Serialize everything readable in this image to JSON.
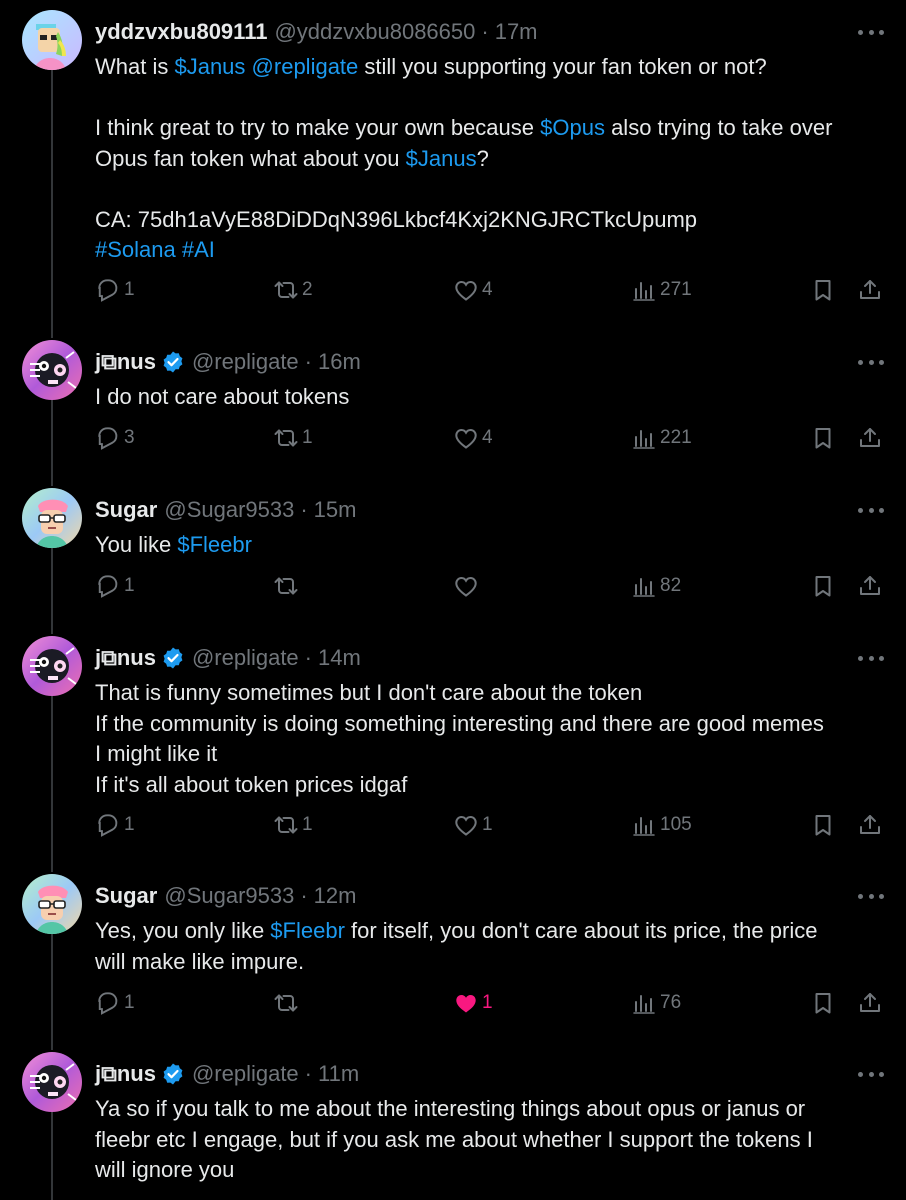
{
  "tweets": [
    {
      "display_name": "yddzvxbu809111",
      "handle": "@yddzvxbu8086650",
      "time": "17m",
      "verified": false,
      "paragraphs": [
        [
          {
            "t": "What is ",
            "link": false
          },
          {
            "t": "$Janus",
            "link": true
          },
          {
            "t": " ",
            "link": false
          },
          {
            "t": "@repligate",
            "link": true
          },
          {
            "t": " still you supporting your fan token or not?",
            "link": false
          }
        ],
        [
          {
            "t": "I think great to try to make your own because ",
            "link": false
          },
          {
            "t": "$Opus",
            "link": true
          },
          {
            "t": " also trying to take over\nOpus fan token what about you ",
            "link": false
          },
          {
            "t": "$Janus",
            "link": true
          },
          {
            "t": "?",
            "link": false
          }
        ],
        [
          {
            "t": "CA: 75dh1aVyE88DiDDqN396Lkbcf4Kxj2KNGJRCTkcUpump\n",
            "link": false
          },
          {
            "t": "#Solana",
            "link": true
          },
          {
            "t": " ",
            "link": false
          },
          {
            "t": "#AI",
            "link": true
          }
        ]
      ],
      "replies": "1",
      "retweets": "2",
      "likes": "4",
      "views": "271",
      "liked": false
    },
    {
      "display_name": "j⧉nus",
      "handle": "@repligate",
      "time": "16m",
      "verified": true,
      "paragraphs": [
        [
          {
            "t": "I do not care about tokens",
            "link": false
          }
        ]
      ],
      "replies": "3",
      "retweets": "1",
      "likes": "4",
      "views": "221",
      "liked": false
    },
    {
      "display_name": "Sugar",
      "handle": "@Sugar9533",
      "time": "15m",
      "verified": false,
      "paragraphs": [
        [
          {
            "t": "You like ",
            "link": false
          },
          {
            "t": "$Fleebr",
            "link": true
          }
        ]
      ],
      "replies": "1",
      "retweets": "",
      "likes": "",
      "views": "82",
      "liked": false
    },
    {
      "display_name": "j⧉nus",
      "handle": "@repligate",
      "time": "14m",
      "verified": true,
      "paragraphs": [
        [
          {
            "t": "That is funny sometimes but I don't care about the token\nIf the community is doing something interesting and there are good memes\nI might like it\nIf it's all about token prices idgaf",
            "link": false
          }
        ]
      ],
      "replies": "1",
      "retweets": "1",
      "likes": "1",
      "views": "105",
      "liked": false
    },
    {
      "display_name": "Sugar",
      "handle": "@Sugar9533",
      "time": "12m",
      "verified": false,
      "paragraphs": [
        [
          {
            "t": "Yes, you only like ",
            "link": false
          },
          {
            "t": "$Fleebr",
            "link": true
          },
          {
            "t": " for itself, you don't care about its price, the price\nwill make like impure.",
            "link": false
          }
        ]
      ],
      "replies": "1",
      "retweets": "",
      "likes": "1",
      "views": "76",
      "liked": true
    },
    {
      "display_name": "j⧉nus",
      "handle": "@repligate",
      "time": "11m",
      "verified": true,
      "paragraphs": [
        [
          {
            "t": "Ya so if you talk to me about the interesting things about opus or janus or\nfleebr etc I engage, but if you ask me about whether I support the tokens I\nwill ignore you",
            "link": false
          }
        ]
      ],
      "replies": "",
      "retweets": "",
      "likes": "",
      "views": "",
      "liked": false
    }
  ],
  "colors": {
    "background": "#000000",
    "text": "#e7e9ea",
    "muted": "#71767b",
    "link": "#1d9bf0",
    "like": "#f91880",
    "thread_line": "#333639"
  },
  "icons": [
    "reply-icon",
    "retweet-icon",
    "heart-icon",
    "views-icon",
    "bookmark-icon",
    "share-icon",
    "more-icon",
    "verified-badge-icon"
  ]
}
